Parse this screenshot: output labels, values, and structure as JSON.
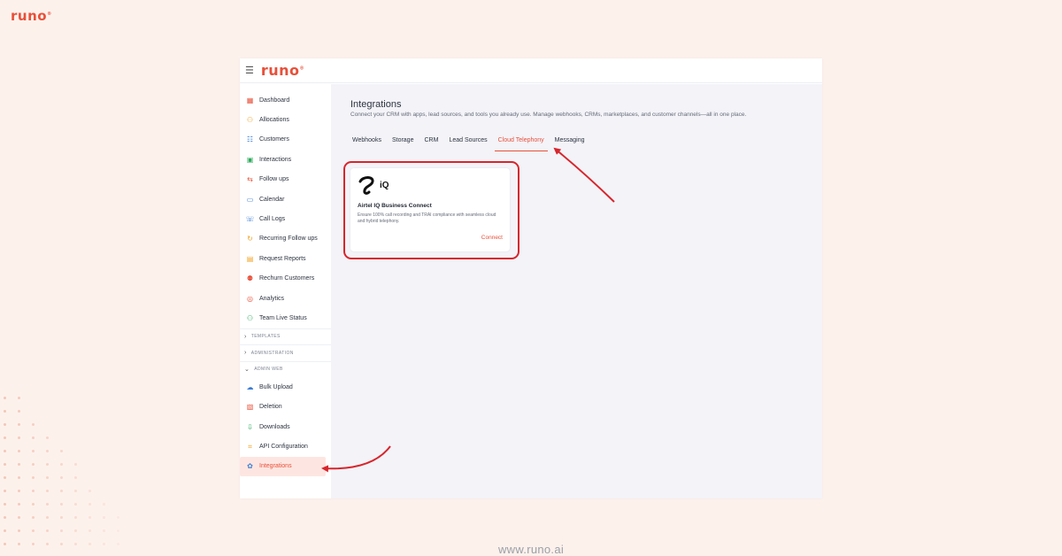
{
  "brand": {
    "logo": "runo"
  },
  "footer": {
    "url": "www.runo.ai"
  },
  "app": {
    "logo": "runo",
    "sidebar": {
      "items": [
        {
          "label": "Dashboard",
          "icon": "dashboard-icon",
          "color": "#e8503a"
        },
        {
          "label": "Allocations",
          "icon": "allocations-icon",
          "color": "#f0a020"
        },
        {
          "label": "Customers",
          "icon": "customers-icon",
          "color": "#3a7bd5"
        },
        {
          "label": "Interactions",
          "icon": "interactions-icon",
          "color": "#2eaa5c"
        },
        {
          "label": "Follow ups",
          "icon": "follow-ups-icon",
          "color": "#e8503a"
        },
        {
          "label": "Calendar",
          "icon": "calendar-icon",
          "color": "#3a7bd5"
        },
        {
          "label": "Call Logs",
          "icon": "call-logs-icon",
          "color": "#3a7bd5"
        },
        {
          "label": "Recurring Follow ups",
          "icon": "recurring-icon",
          "color": "#f0a020"
        },
        {
          "label": "Request Reports",
          "icon": "reports-icon",
          "color": "#f0a020"
        },
        {
          "label": "Rechurn Customers",
          "icon": "rechurn-icon",
          "color": "#e8503a"
        },
        {
          "label": "Analytics",
          "icon": "analytics-icon",
          "color": "#e8503a"
        },
        {
          "label": "Team Live Status",
          "icon": "team-status-icon",
          "color": "#2eaa5c"
        }
      ],
      "sections": {
        "templates": "TEMPLATES",
        "administration": "ADMINISTRATION",
        "admin_web": "ADMIN WEB"
      },
      "admin_items": [
        {
          "label": "Bulk Upload",
          "icon": "cloud-upload-icon",
          "color": "#3a7bd5"
        },
        {
          "label": "Deletion",
          "icon": "deletion-icon",
          "color": "#e8503a"
        },
        {
          "label": "Downloads",
          "icon": "download-icon",
          "color": "#2eaa5c"
        },
        {
          "label": "API Configuration",
          "icon": "api-icon",
          "color": "#f0a020"
        },
        {
          "label": "Integrations",
          "icon": "integrations-icon",
          "color": "#3a7bd5"
        }
      ]
    },
    "main": {
      "title": "Integrations",
      "description": "Connect your CRM with apps, lead sources, and tools you already use. Manage webhooks, CRMs, marketplaces, and customer channels—all in one place.",
      "tabs": [
        "Webhooks",
        "Storage",
        "CRM",
        "Lead Sources",
        "Cloud Telephony",
        "Messaging"
      ],
      "active_tab": "Cloud Telephony",
      "card": {
        "logo_text": "iQ",
        "title": "Airtel IQ Business Connect",
        "description": "Ensure 100% call recording and TRAI compliance with seamless cloud and hybrid telephony.",
        "action": "Connect"
      }
    }
  },
  "colors": {
    "accent": "#e8503a",
    "annotation_red": "#d8252c",
    "background": "#fdf1ec"
  }
}
